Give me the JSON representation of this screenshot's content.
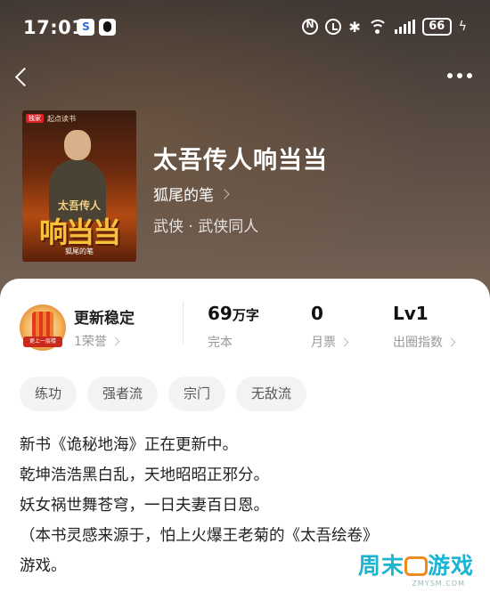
{
  "status_bar": {
    "time": "17:01",
    "app1_glyph": "S",
    "battery": "66"
  },
  "book": {
    "title": "太吾传人响当当",
    "author": "狐尾的笔",
    "genre": "武侠 · 武侠同人",
    "cover": {
      "badge": "独家",
      "publisher": "起点读书",
      "subtitle": "太吾传人",
      "title": "响当当",
      "author": "狐尾的笔"
    }
  },
  "stats": {
    "medal_text": "更上一层楼",
    "status_label": "更新稳定",
    "honor": "1荣誉",
    "word_count": "69",
    "word_unit": "万字",
    "word_status": "完本",
    "monthly_tickets": "0",
    "monthly_label": "月票",
    "level": "Lv1",
    "level_label": "出圈指数"
  },
  "tags": [
    "练功",
    "强者流",
    "宗门",
    "无敌流"
  ],
  "description": [
    "新书《诡秘地海》正在更新中。",
    "乾坤浩浩黑白乱，天地昭昭正邪分。",
    "妖女祸世舞苍穹，一日夫妻百日恩。",
    "（本书灵感来源于，怕上火爆王老菊的《太吾绘卷》",
    "游戏。"
  ],
  "watermark": {
    "left": "周末",
    "right": "游戏",
    "url": "ZMYSM.COM"
  },
  "icons": [
    "back-arrow-icon",
    "more-dots-icon",
    "chevron-right-icon",
    "medal-icon",
    "nfc-icon",
    "alarm-icon",
    "bluetooth-icon",
    "wifi-icon",
    "signal-icon",
    "battery-icon"
  ],
  "colors": {
    "hero_bg": "#4a3f3a",
    "card_bg": "#ffffff",
    "tag_bg": "#f3f3f3",
    "watermark_blue": "#1ab5d2",
    "watermark_orange": "#f08a1d"
  }
}
